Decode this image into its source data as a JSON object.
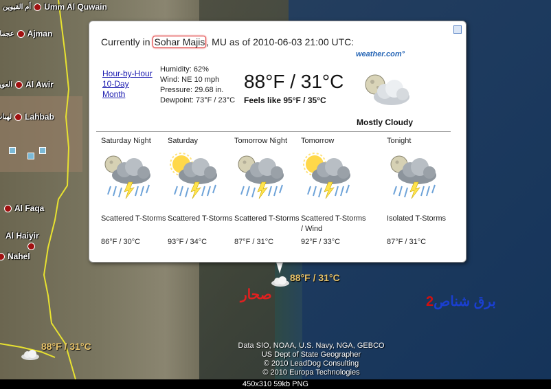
{
  "map": {
    "places": [
      {
        "label": "Umm Al Quwain"
      },
      {
        "label": "أم القيوين"
      },
      {
        "label": "Ajman"
      },
      {
        "label": "عجمان"
      },
      {
        "label": "Al Awir"
      },
      {
        "label": "العوير"
      },
      {
        "label": "Lahbab"
      },
      {
        "label": "لهباب"
      },
      {
        "label": "Al Faqa"
      },
      {
        "label": "Al Haiyir"
      },
      {
        "label": "Nahel"
      }
    ],
    "temp_labels": [
      "88°F / 31°C",
      "88°F / 31°C"
    ],
    "city_arabic": "صحار",
    "signature_prefix": "برق شناص",
    "signature_number": "2",
    "credits": [
      "Data SIO, NOAA, U.S. Navy, NGA, GEBCO",
      "US Dept of State Geographer",
      "© 2010 LeadDog Consulting",
      "© 2010 Europa Technologies"
    ]
  },
  "status_bar": "450x310  59kb  PNG",
  "popup": {
    "title_prefix": "Currently in",
    "location": "Sohar Majis",
    "title_suffix": ", MU as of 2010-06-03 21:00 UTC:",
    "links": [
      "Hour-by-Hour",
      "10-Day",
      "Month"
    ],
    "humidity": "Humidity: 62%",
    "wind": "Wind: NE 10 mph",
    "pressure": "Pressure: 29.68 in.",
    "dewpoint": "Dewpoint: 73°F / 23°C",
    "temperature": "88°F / 31°C",
    "feels_like": "Feels like 95°F / 35°C",
    "brand": "weather.com°",
    "condition": "Mostly Cloudy",
    "icon": "moon-cloud-icon",
    "forecast": [
      {
        "name": "Saturday Night",
        "desc": "Scattered T-Storms",
        "temps": "86°F / 30°C",
        "icon": "night-storm-icon"
      },
      {
        "name": "Saturday",
        "desc": "Scattered T-Storms",
        "temps": "93°F / 34°C",
        "icon": "sun-storm-icon"
      },
      {
        "name": "Tomorrow Night",
        "desc": "Scattered T-Storms",
        "temps": "87°F / 31°C",
        "icon": "night-storm-icon"
      },
      {
        "name": "Tomorrow",
        "desc": "Scattered T-Storms / Wind",
        "temps": "92°F / 33°C",
        "icon": "sun-storm-icon"
      },
      {
        "name": "Tonight",
        "desc": "Isolated T-Storms",
        "temps": "87°F / 31°C",
        "icon": "night-storm-icon"
      }
    ]
  }
}
